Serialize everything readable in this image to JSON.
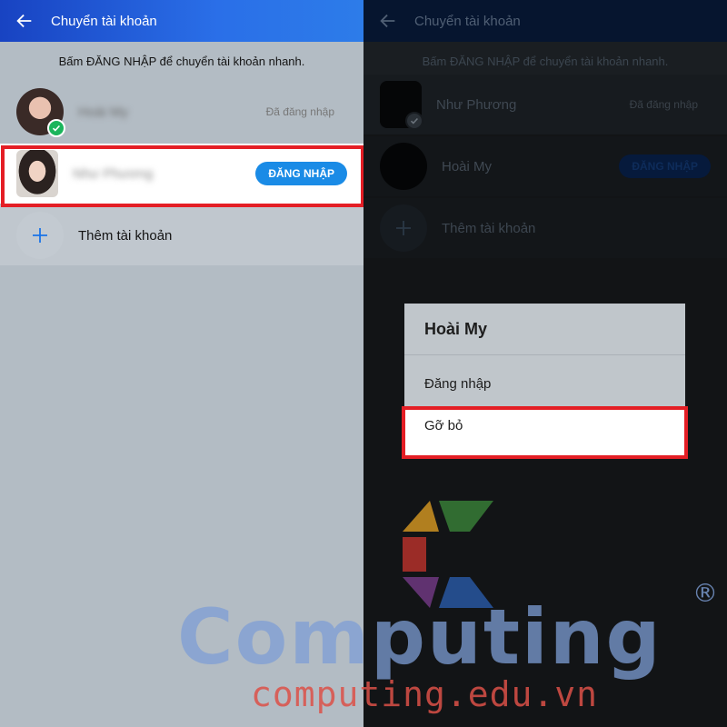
{
  "left": {
    "header_title": "Chuyển tài khoản",
    "hint": "Bấm ĐĂNG NHẬP để chuyển tài khoản nhanh.",
    "accounts": [
      {
        "name": "Hoài My",
        "status": "Đã đăng nhập"
      },
      {
        "name": "Như Phương",
        "button": "ĐĂNG NHẬP"
      }
    ],
    "add_account": "Thêm tài khoản"
  },
  "right": {
    "header_title": "Chuyển tài khoản",
    "hint": "Bấm ĐĂNG NHẬP để chuyển tài khoản nhanh.",
    "accounts": [
      {
        "name": "Như Phương",
        "status": "Đã đăng nhập"
      },
      {
        "name": "Hoài My",
        "button": "ĐĂNG NHẬP"
      }
    ],
    "add_account": "Thêm tài khoản",
    "dialog": {
      "title": "Hoài My",
      "items": [
        "Đăng nhập",
        "Gỡ bỏ"
      ]
    }
  },
  "watermark": {
    "brand": "Computing",
    "registered": "®",
    "url": "computing.edu.vn"
  },
  "colors": {
    "accent_blue": "#1a8be6",
    "highlight_red": "#e41e25",
    "online_green": "#1bb55c"
  }
}
